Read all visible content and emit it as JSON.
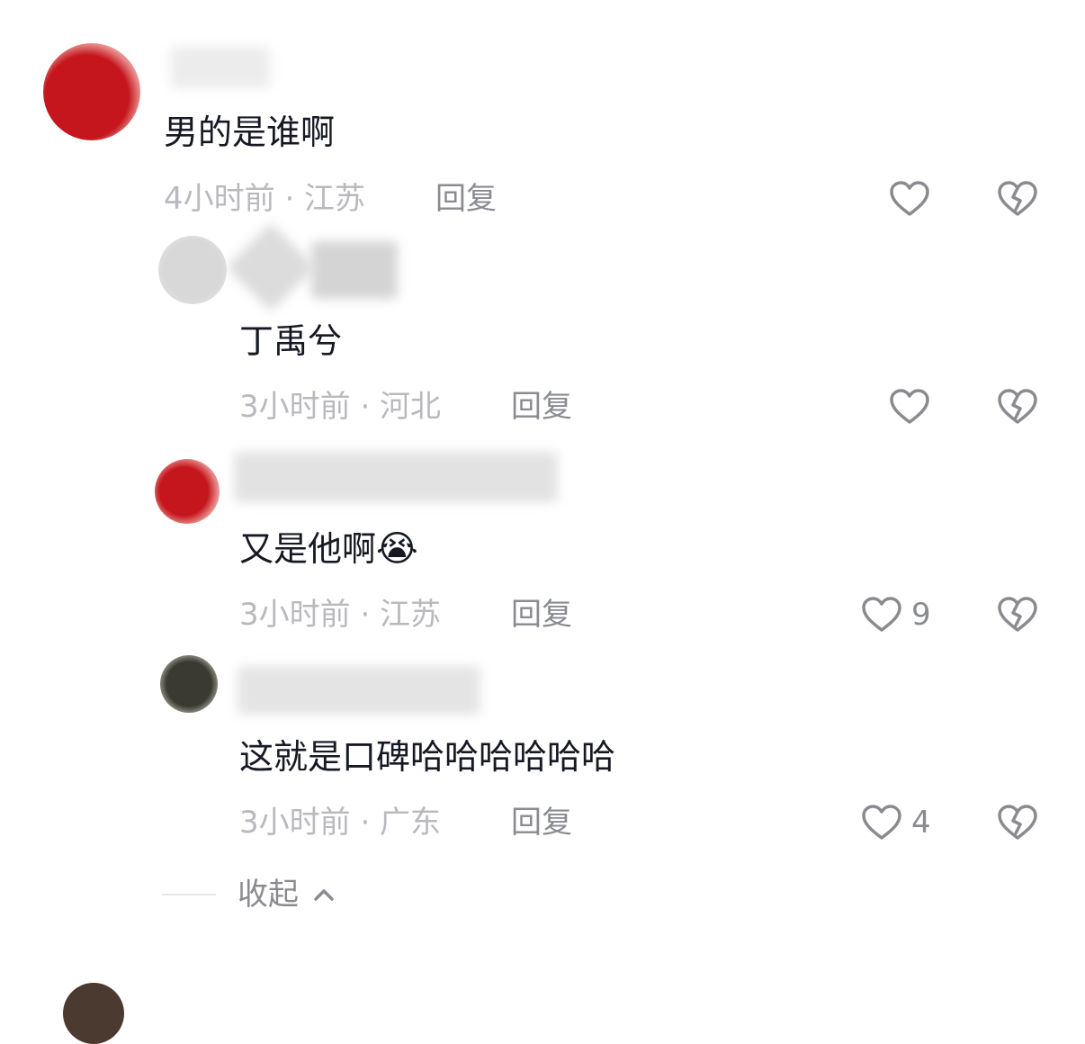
{
  "comments": [
    {
      "text": "男的是谁啊",
      "meta": "4小时前 · 江苏",
      "reply_label": "回复",
      "like_count": "",
      "avatar_color": "#c4161c"
    },
    {
      "text": "丁禹兮",
      "meta": "3小时前 · 河北",
      "reply_label": "回复",
      "like_count": "",
      "avatar_color": "#c9c9c9"
    },
    {
      "text": "又是他啊",
      "emoji": "😭",
      "meta": "3小时前 · 江苏",
      "reply_label": "回复",
      "like_count": "9",
      "avatar_color": "#c4161c"
    },
    {
      "text": "这就是口碑哈哈哈哈哈哈",
      "meta": "3小时前 · 广东",
      "reply_label": "回复",
      "like_count": "4",
      "avatar_color": "#3a3a30"
    }
  ],
  "collapse": {
    "label": "收起"
  },
  "colors": {
    "text": "#161823",
    "meta": "#b9b9be",
    "action": "#8a8b91",
    "brand_red": "#c4161c"
  }
}
